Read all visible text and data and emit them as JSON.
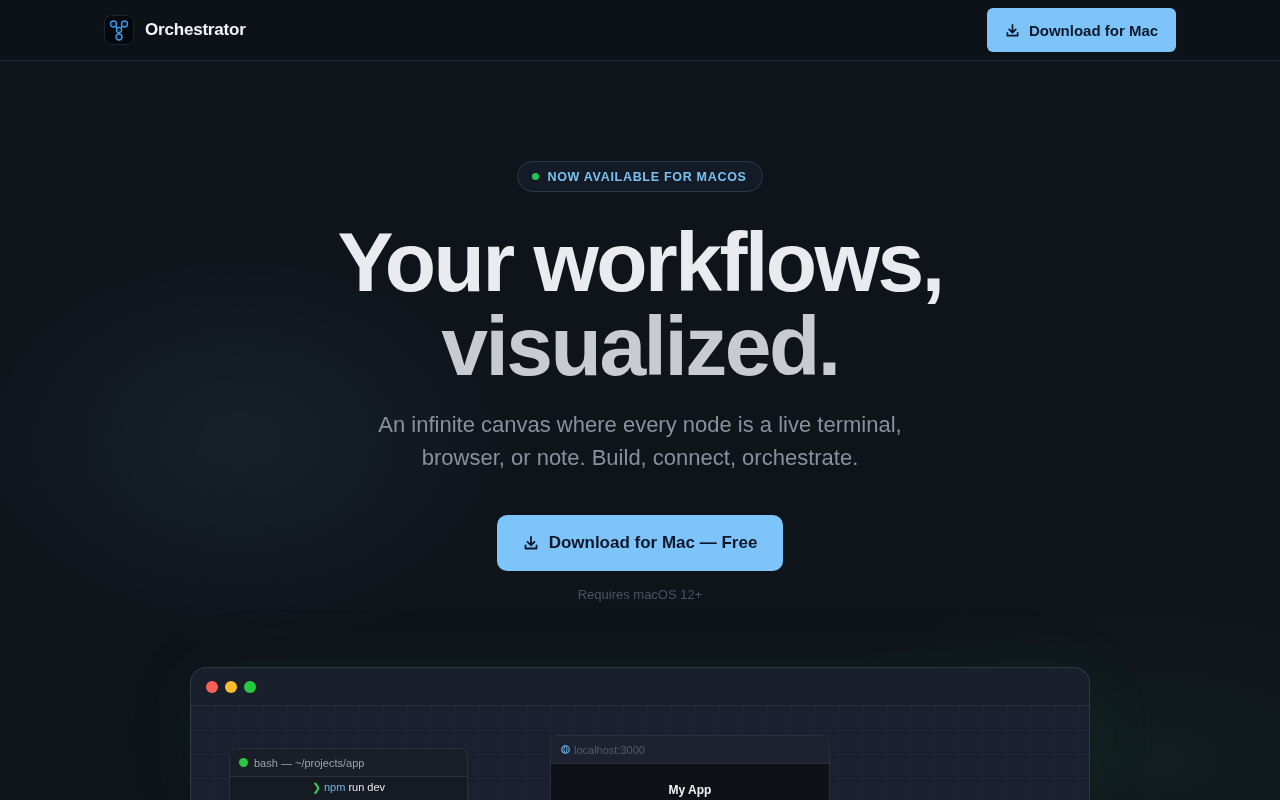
{
  "header": {
    "brand": "Orchestrator",
    "download_button": {
      "label": "Download for Mac"
    }
  },
  "hero": {
    "badge": {
      "label": "NOW AVAILABLE FOR MACOS"
    },
    "title_lines": [
      "Your workflows,",
      "visualized."
    ],
    "subtitle": "An infinite canvas where every node is a live terminal, browser, or note. Build, connect, orchestrate.",
    "cta_button": {
      "label": "Download for Mac — Free"
    },
    "requirement": "Requires macOS 12+"
  },
  "app_preview": {
    "nodes": [
      {
        "kind": "terminal",
        "title": "bash — ~/projects/app",
        "lines": [
          {
            "prompt": "❯",
            "command": "npm",
            "args": "run dev"
          }
        ]
      },
      {
        "kind": "browser",
        "url": "localhost:3000",
        "page_title": "My App"
      }
    ]
  }
}
